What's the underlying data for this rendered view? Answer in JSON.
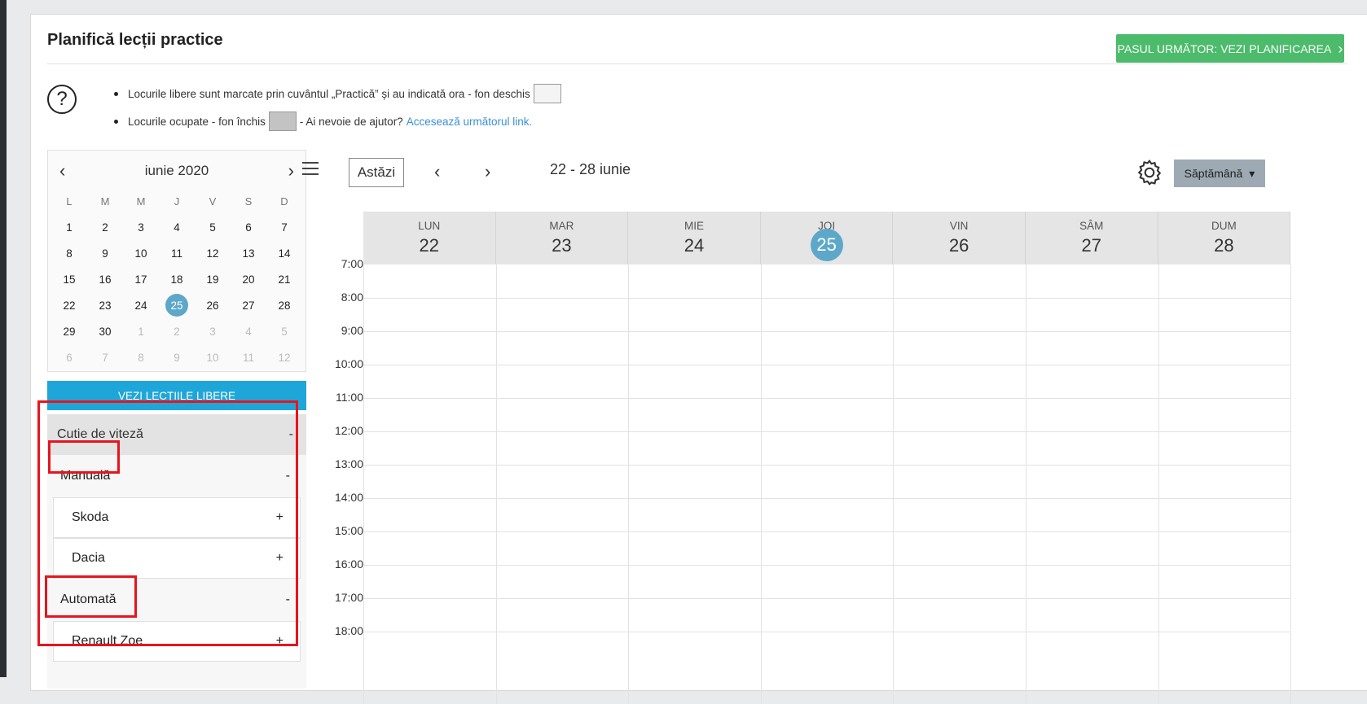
{
  "page": {
    "title": "Planifică lecții practice",
    "next_button": "PASUL URMĂTOR: VEZI PLANIFICAREA",
    "info": {
      "line1": "Locurile libere sunt marcate prin cuvântul „Practică” și au indicată ora - fon deschis",
      "line2_a": "Locurile ocupate - fon închis",
      "line2_b": "- Ai nevoie de ajutor?",
      "link": "Accesează următorul link."
    }
  },
  "mini_calendar": {
    "month": "iunie 2020",
    "weekdays": [
      "L",
      "M",
      "M",
      "J",
      "V",
      "S",
      "D"
    ],
    "weeks": [
      [
        "1",
        "2",
        "3",
        "4",
        "5",
        "6",
        "7"
      ],
      [
        "8",
        "9",
        "10",
        "11",
        "12",
        "13",
        "14"
      ],
      [
        "15",
        "16",
        "17",
        "18",
        "19",
        "20",
        "21"
      ],
      [
        "22",
        "23",
        "24",
        "25",
        "26",
        "27",
        "28"
      ],
      [
        "29",
        "30",
        "1",
        "2",
        "3",
        "4",
        "5"
      ],
      [
        "6",
        "7",
        "8",
        "9",
        "10",
        "11",
        "12"
      ]
    ]
  },
  "free_lessons_button": "VEZI LECȚIILE LIBERE",
  "gearbox": {
    "title": "Cutie de viteză",
    "toggle": "-",
    "groups": [
      {
        "label": "Manuală",
        "toggle": "-",
        "cars": [
          {
            "label": "Skoda",
            "toggle": "+"
          },
          {
            "label": "Dacia",
            "toggle": "+"
          }
        ]
      },
      {
        "label": "Automată",
        "toggle": "-",
        "cars": [
          {
            "label": "Renault Zoe",
            "toggle": "+"
          }
        ]
      }
    ]
  },
  "toolbar": {
    "today": "Astăzi",
    "range": "22 - 28 iunie",
    "view": "Săptămână"
  },
  "week": {
    "days": [
      {
        "name": "LUN",
        "num": "22"
      },
      {
        "name": "MAR",
        "num": "23"
      },
      {
        "name": "MIE",
        "num": "24"
      },
      {
        "name": "JOI",
        "num": "25"
      },
      {
        "name": "VIN",
        "num": "26"
      },
      {
        "name": "SÂM",
        "num": "27"
      },
      {
        "name": "DUM",
        "num": "28"
      }
    ],
    "hours": [
      "7:00",
      "8:00",
      "9:00",
      "10:00",
      "11:00",
      "12:00",
      "13:00",
      "14:00",
      "15:00",
      "16:00",
      "17:00",
      "18:00"
    ]
  },
  "colors": {
    "accent_green": "#4cbb6c",
    "accent_blue": "#1fa6d9",
    "today_circle": "#5da8c9",
    "highlight_red": "#e8141d"
  }
}
